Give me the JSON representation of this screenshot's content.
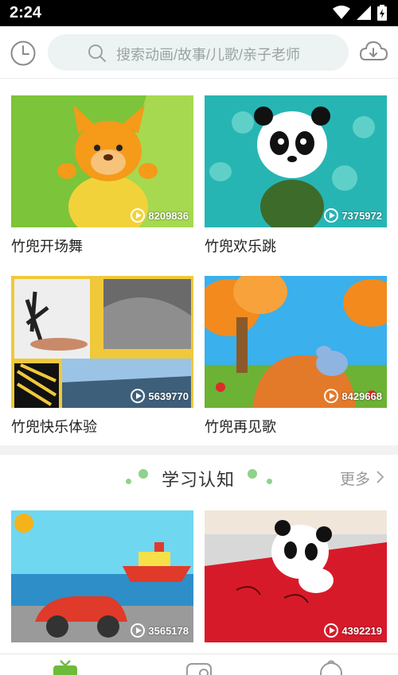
{
  "status_bar": {
    "time": "2:24"
  },
  "search": {
    "placeholder": "搜索动画/故事/儿歌/亲子老师"
  },
  "grid": [
    {
      "title": "竹兜开场舞",
      "views": "8209836"
    },
    {
      "title": "竹兜欢乐跳",
      "views": "7375972"
    },
    {
      "title": "竹兜快乐体验",
      "views": "5639770"
    },
    {
      "title": "竹兜再见歌",
      "views": "8429668"
    }
  ],
  "section": {
    "title": "学习认知",
    "more_label": "更多",
    "items": [
      {
        "views": "3565178"
      },
      {
        "views": "4392219"
      }
    ]
  },
  "colors": {
    "accent": "#8fd28a",
    "status_bar": "#000000"
  }
}
